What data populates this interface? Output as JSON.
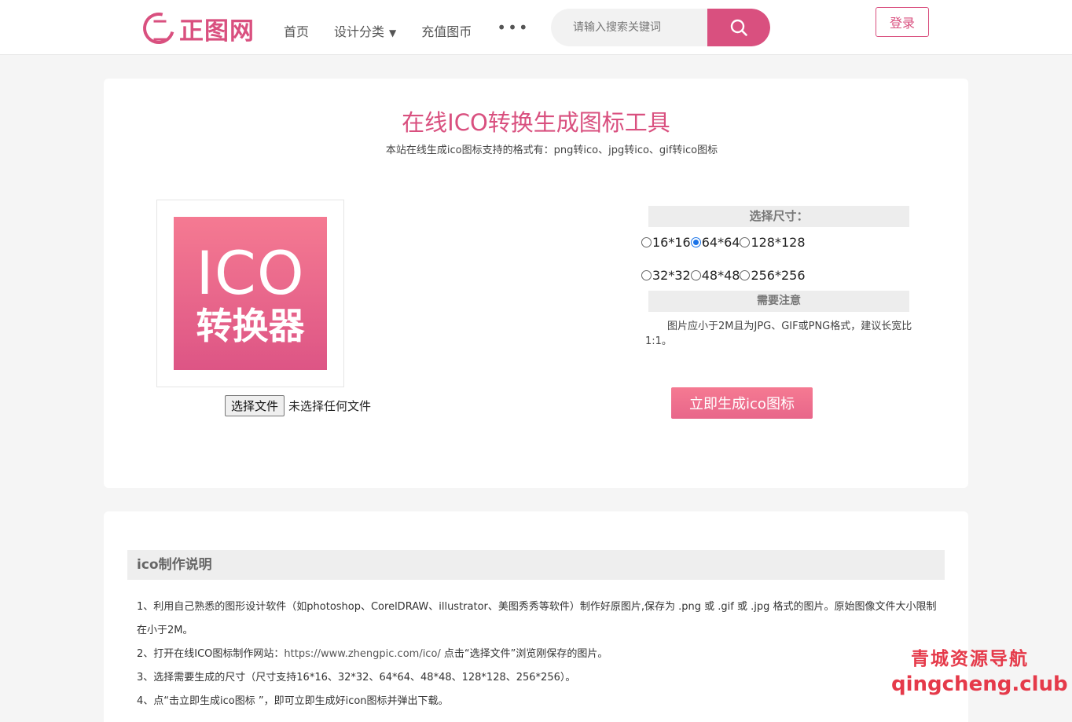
{
  "header": {
    "logo_text": "正图网",
    "nav": [
      {
        "label": "首页"
      },
      {
        "label": "设计分类"
      },
      {
        "label": "充值图币"
      }
    ],
    "nav_more": "•••",
    "search_placeholder": "请输入搜索关键词",
    "login_label": "登录"
  },
  "tool": {
    "title": "在线ICO转换生成图标工具",
    "subtitle": "本站在线生成ico图标支持的格式有：png转ico、jpg转ico、gif转ico图标",
    "preview_big": "ICO",
    "preview_cn": "转换器",
    "file_button": "选择文件",
    "file_status": "未选择任何文件",
    "size_heading": "选择尺寸：",
    "sizes_row1": [
      "16*16",
      "64*64",
      "128*128"
    ],
    "sizes_row2": [
      "32*32",
      "48*48",
      "256*256"
    ],
    "selected_size": "64*64",
    "note_heading": "需要注意",
    "note_text": "图片应小于2M且为JPG、GIF或PNG格式，建议长宽比1:1。",
    "generate_button": "立即生成ico图标"
  },
  "info": {
    "heading": "ico制作说明",
    "step1": "1、利用自己熟悉的图形设计软件（如photoshop、CorelDRAW、illustrator、美图秀秀等软件）制作好原图片,保存为 .png 或 .gif 或 .jpg 格式的图片。原始图像文件大小限制在小于2M。",
    "step2_pre": "2、打开在线ICO图标制作网站：",
    "step2_link": "https://www.zhengpic.com/ico/",
    "step2_post": " 点击“选择文件”浏览刚保存的图片。",
    "step3": "3、选择需要生成的尺寸（尺寸支持16*16、32*32、64*64、48*48、128*128、256*256）。",
    "step4": "4、点“击立即生成ico图标 ”，即可立即生成好icon图标并弹出下载。"
  },
  "watermark": {
    "line1": "青城资源导航",
    "line2": "qingcheng.club"
  },
  "colors": {
    "brand": "#d9507f",
    "button_pink": "#f57a92",
    "radio_blue": "#1a73e8"
  }
}
